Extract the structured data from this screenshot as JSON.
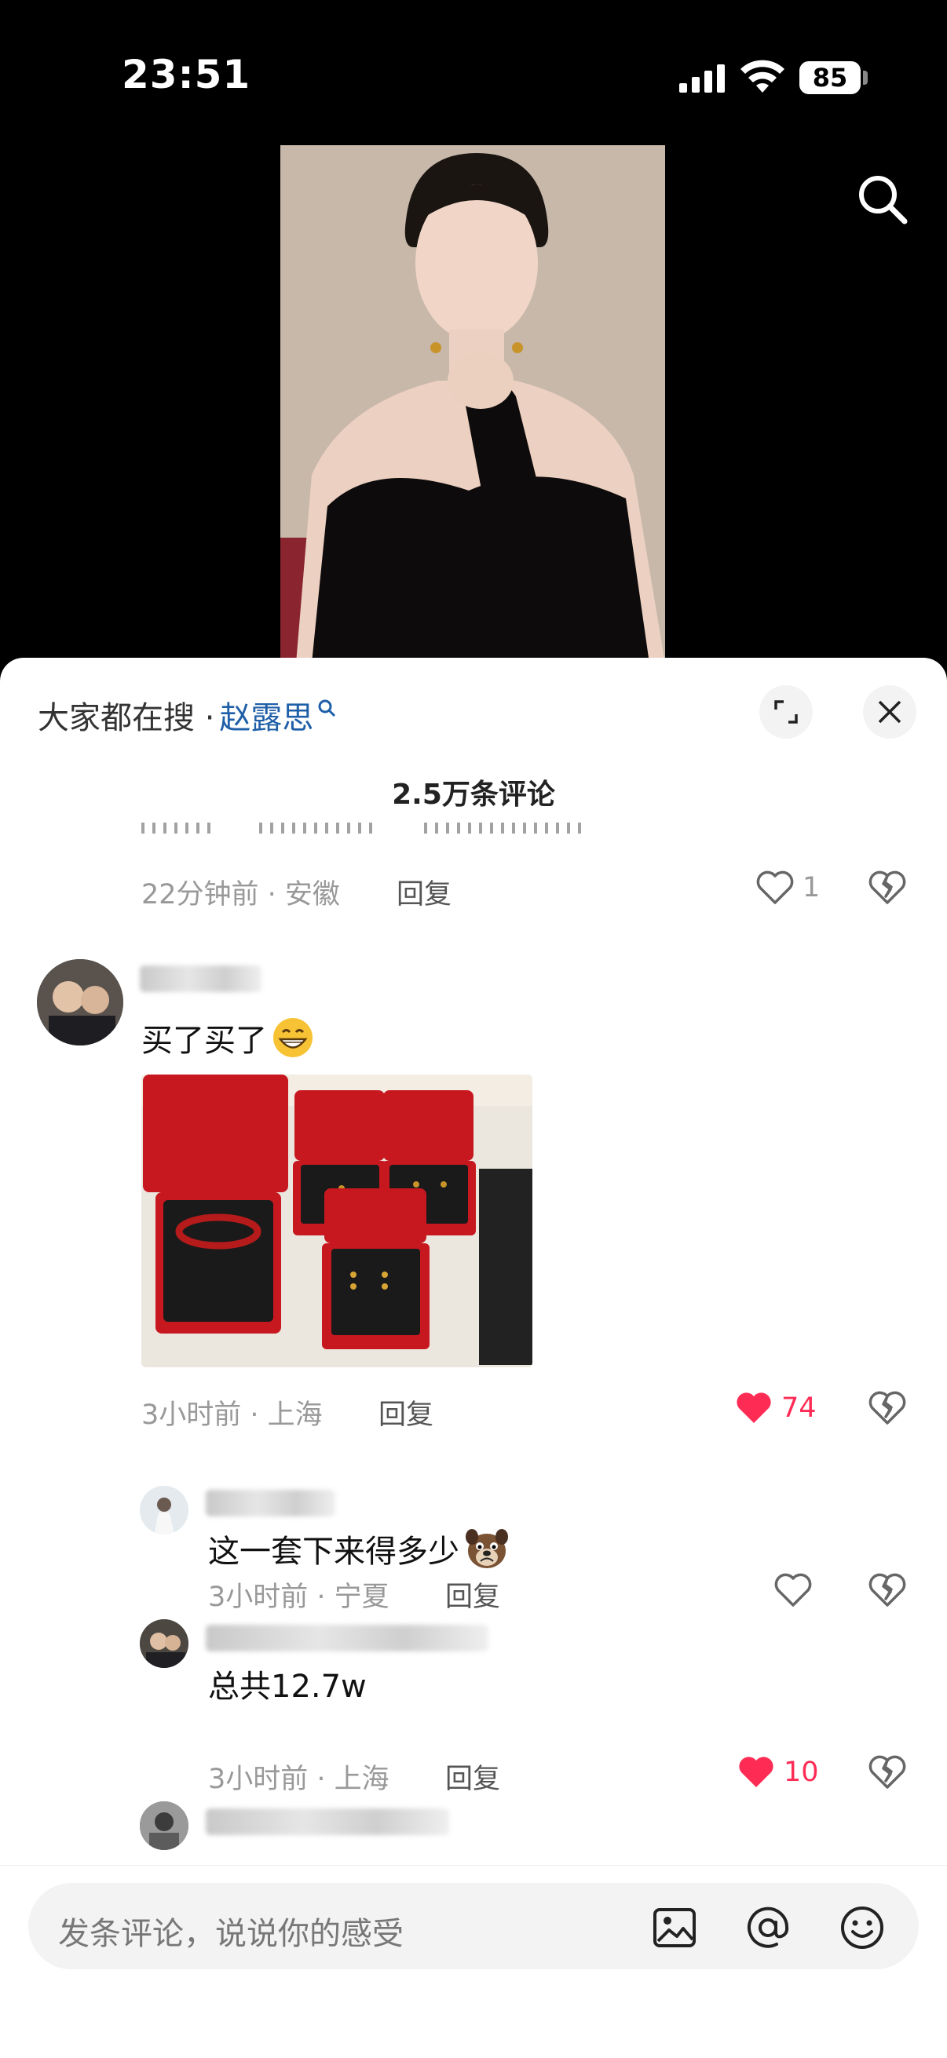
{
  "status_bar": {
    "time": "23:51",
    "battery": "85"
  },
  "sheet": {
    "hot_search_prefix": "大家都在搜 · ",
    "hot_search_term": "赵露思",
    "comment_count": "2.5万条评论"
  },
  "comments": [
    {
      "time_location": "22分钟前 · 安徽",
      "reply": "回复",
      "likes": "1",
      "liked": false
    },
    {
      "text": "买了买了",
      "time_location": "3小时前 · 上海",
      "reply": "回复",
      "likes": "74",
      "liked": true
    },
    {
      "text": "这一套下来得多少",
      "time_location": "3小时前 · 宁夏",
      "reply": "回复",
      "likes": "",
      "liked": false
    },
    {
      "text": "总共12.7w",
      "time_location": "3小时前 · 上海",
      "reply": "回复",
      "likes": "10",
      "liked": true
    }
  ],
  "input": {
    "placeholder": "发条评论，说说你的感受"
  },
  "colors": {
    "accent_like": "#fe2c55",
    "link_blue": "#1f5fa8"
  }
}
